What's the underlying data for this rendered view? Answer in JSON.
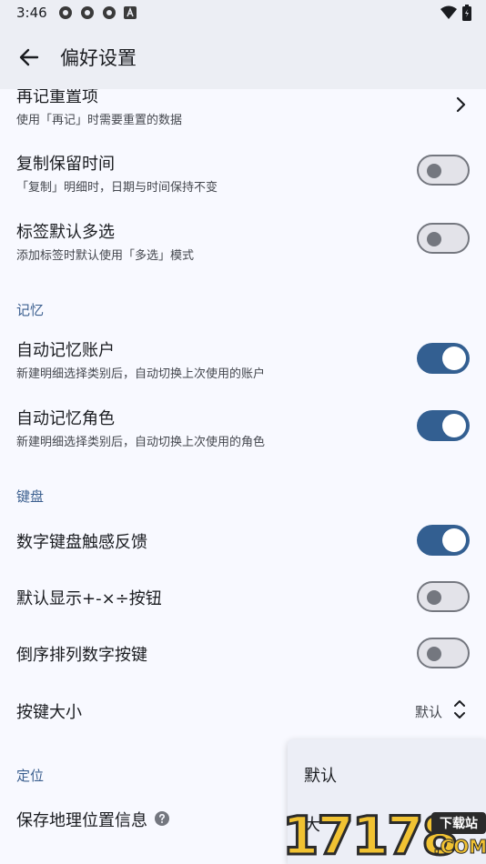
{
  "status_bar": {
    "time": "3:46"
  },
  "app_bar": {
    "title": "偏好设置"
  },
  "settings": {
    "record_reset": {
      "title": "再记重置项",
      "subtitle": "使用「再记」时需要重置的数据"
    },
    "copy_keep_time": {
      "title": "复制保留时间",
      "subtitle": "「复制」明细时，日期与时间保持不变",
      "on": false
    },
    "tag_multi": {
      "title": "标签默认多选",
      "subtitle": "添加标签时默认使用「多选」模式",
      "on": false
    },
    "memory_header": "记忆",
    "auto_account": {
      "title": "自动记忆账户",
      "subtitle": "新建明细选择类别后，自动切换上次使用的账户",
      "on": true
    },
    "auto_role": {
      "title": "自动记忆角色",
      "subtitle": "新建明细选择类别后，自动切换上次使用的角色",
      "on": true
    },
    "keyboard_header": "键盘",
    "haptic": {
      "title": "数字键盘触感反馈",
      "on": true
    },
    "show_ops": {
      "title": "默认显示+-×÷按钮",
      "on": false
    },
    "reverse_keys": {
      "title": "倒序排列数字按键",
      "on": false
    },
    "key_size": {
      "title": "按键大小",
      "value": "默认"
    },
    "location_header": "定位",
    "save_location": {
      "title": "保存地理位置信息"
    }
  },
  "popup": {
    "options": [
      "默认",
      "大"
    ]
  },
  "watermark": {
    "digits": "17178",
    "badge": "下载站",
    "domain": ".COM"
  },
  "colors": {
    "accent": "#335f91",
    "section": "#3b5f8f",
    "appbar": "#eceef4",
    "background": "#f8f9ff"
  }
}
